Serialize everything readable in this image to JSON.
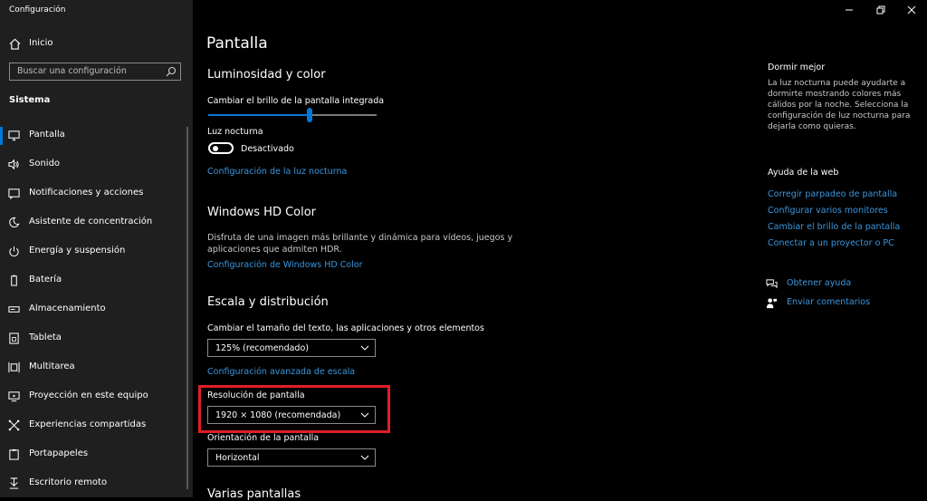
{
  "window": {
    "title": "Configuración"
  },
  "sidebar": {
    "home_label": "Inicio",
    "search_placeholder": "Buscar una configuración",
    "section": "Sistema",
    "items": [
      {
        "label": "Pantalla",
        "icon": "display-icon",
        "active": true
      },
      {
        "label": "Sonido",
        "icon": "speaker-icon"
      },
      {
        "label": "Notificaciones y acciones",
        "icon": "notification-icon"
      },
      {
        "label": "Asistente de concentración",
        "icon": "moon-icon"
      },
      {
        "label": "Energía y suspensión",
        "icon": "power-icon"
      },
      {
        "label": "Batería",
        "icon": "battery-icon"
      },
      {
        "label": "Almacenamiento",
        "icon": "storage-icon"
      },
      {
        "label": "Tableta",
        "icon": "tablet-icon"
      },
      {
        "label": "Multitarea",
        "icon": "multitask-icon"
      },
      {
        "label": "Proyección en este equipo",
        "icon": "projection-icon"
      },
      {
        "label": "Experiencias compartidas",
        "icon": "shared-icon"
      },
      {
        "label": "Portapapeles",
        "icon": "clipboard-icon"
      },
      {
        "label": "Escritorio remoto",
        "icon": "remote-desktop-icon"
      }
    ]
  },
  "main": {
    "title": "Pantalla",
    "brightness": {
      "heading": "Luminosidad y color",
      "slider_label": "Cambiar el brillo de la pantalla integrada",
      "slider_value": 0.6,
      "night_light_label": "Luz nocturna",
      "night_light_state": "Desactivado",
      "night_light_link": "Configuración de la luz nocturna"
    },
    "hdr": {
      "heading": "Windows HD Color",
      "description_line1": "Disfruta de una imagen más brillante y dinámica para vídeos, juegos y",
      "description_line2": "aplicaciones que admiten HDR.",
      "link": "Configuración de Windows HD Color"
    },
    "scale": {
      "heading": "Escala y distribución",
      "size_label": "Cambiar el tamaño del texto, las aplicaciones y otros elementos",
      "size_value": "125% (recomendado)",
      "advanced_link": "Configuración avanzada de escala",
      "resolution_label": "Resolución de pantalla",
      "resolution_value": "1920 × 1080 (recomendada)",
      "orientation_label": "Orientación de la pantalla",
      "orientation_value": "Horizontal"
    },
    "multi_heading": "Varias pantallas"
  },
  "right": {
    "sleep_heading": "Dormir mejor",
    "sleep_lines": [
      "La luz nocturna puede ayudarte a",
      "dormirte mostrando colores más",
      "cálidos por la noche. Selecciona la",
      "configuración de luz nocturna para",
      "dejarla como quieras."
    ],
    "web_heading": "Ayuda de la web",
    "web_links": [
      "Corregir parpadeo de pantalla",
      "Configurar varios monitores",
      "Cambiar el brillo de la pantalla",
      "Conectar a un proyector o PC"
    ],
    "help_label": "Obtener ayuda",
    "feedback_label": "Enviar comentarios"
  },
  "colors": {
    "accent": "#0078d7",
    "link": "#3a96dd",
    "highlight": "#e01e28",
    "sidebar_bg": "#1f1f1f"
  }
}
